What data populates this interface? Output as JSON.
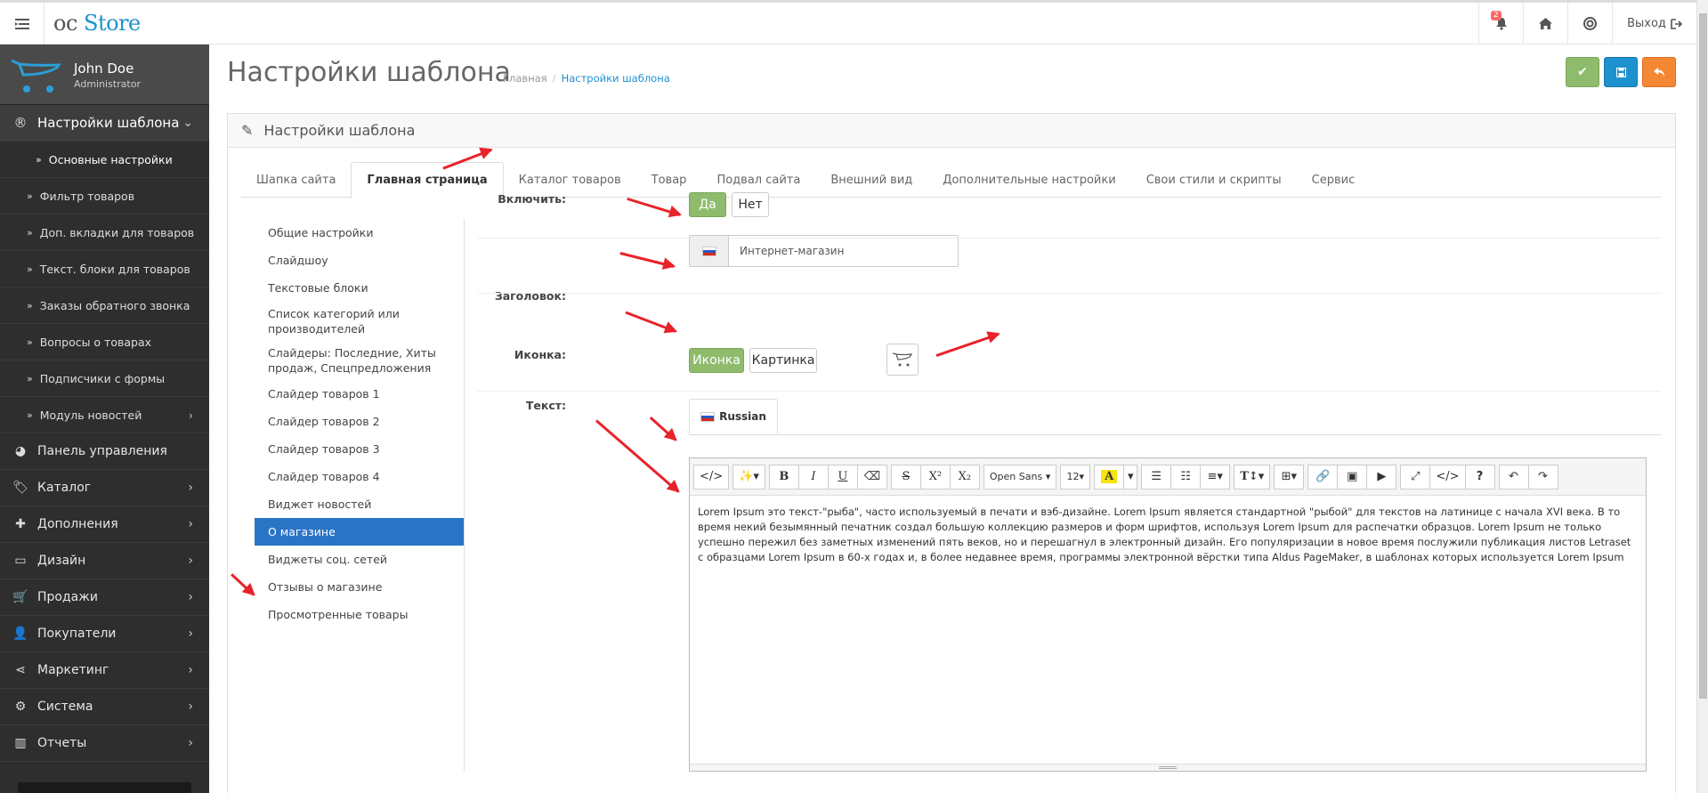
{
  "header": {
    "logo_oc": "oc",
    "logo_store": "Store",
    "notification_count": "2",
    "exit_label": "Выход"
  },
  "user": {
    "name": "John Doe",
    "role": "Administrator"
  },
  "sidebar": {
    "section": "Настройки шаблона",
    "sub_items": [
      {
        "label": "Основные настройки",
        "active": true
      },
      {
        "label": "Фильтр товаров"
      },
      {
        "label": "Доп. вкладки для товаров"
      },
      {
        "label": "Текст. блоки для товаров"
      },
      {
        "label": "Заказы обратного звонка"
      },
      {
        "label": "Вопросы о товарах"
      },
      {
        "label": "Подписчики с формы"
      },
      {
        "label": "Модуль новостей"
      }
    ],
    "items": [
      {
        "label": "Панель управления",
        "icon": "dashboard-icon"
      },
      {
        "label": "Каталог",
        "icon": "tag-icon"
      },
      {
        "label": "Дополнения",
        "icon": "puzzle-icon"
      },
      {
        "label": "Дизайн",
        "icon": "monitor-icon"
      },
      {
        "label": "Продажи",
        "icon": "cart-icon"
      },
      {
        "label": "Покупатели",
        "icon": "user-icon"
      },
      {
        "label": "Маркетинг",
        "icon": "share-icon"
      },
      {
        "label": "Система",
        "icon": "cog-icon"
      },
      {
        "label": "Отчеты",
        "icon": "bar-chart-icon"
      }
    ]
  },
  "page": {
    "title": "Настройки шаблона",
    "breadcrumb_home": "Главная",
    "breadcrumb_current": "Настройки шаблона",
    "panel_title": "Настройки шаблона"
  },
  "tabs": [
    {
      "label": "Шапка сайта"
    },
    {
      "label": "Главная страница",
      "active": true
    },
    {
      "label": "Каталог товаров"
    },
    {
      "label": "Товар"
    },
    {
      "label": "Подвал сайта"
    },
    {
      "label": "Внешний вид"
    },
    {
      "label": "Дополнительные настройки"
    },
    {
      "label": "Свои стили и скрипты"
    },
    {
      "label": "Сервис"
    }
  ],
  "leftnav": [
    "Общие настройки",
    "Слайдшоу",
    "Текстовые блоки",
    "Список категорий или производителей",
    "Слайдеры: Последние, Хиты продаж, Спецпредложения",
    "Слайдер товаров 1",
    "Слайдер товаров 2",
    "Слайдер товаров 3",
    "Слайдер товаров 4",
    "Виджет новостей",
    "О магазине",
    "Виджеты соц. сетей",
    "Отзывы о магазине",
    "Просмотренные товары"
  ],
  "leftnav_active": "О магазине",
  "form": {
    "enable_label": "Включить:",
    "enable_yes": "Да",
    "enable_no": "Нет",
    "heading_label": "Заголовок:",
    "heading_value": "Интернет-магазин",
    "icon_label": "Иконка:",
    "icon_opt1": "Иконка",
    "icon_opt2": "Картинка",
    "text_label": "Текст:",
    "lang_tab": "Russian"
  },
  "editor": {
    "font_family": "Open Sans",
    "font_size": "12",
    "content": "Lorem Ipsum это текст-\"рыба\", часто используемый в печати и вэб-дизайне. Lorem Ipsum является стандартной \"рыбой\" для текстов на латинице с начала XVI века. В то время некий безымянный печатник создал большую коллекцию размеров и форм шрифтов, используя Lorem Ipsum для распечатки образцов. Lorem Ipsum не только успешно пережил без заметных изменений пять веков, но и перешагнул в электронный дизайн. Его популяризации в новое время послужили публикация листов Letraset с образцами Lorem Ipsum в 60-х годах и, в более недавнее время, программы электронной вёрстки типа Aldus PageMaker, в шаблонах которых используется Lorem Ipsum"
  },
  "colors": {
    "accent_blue": "#1e91cf",
    "green": "#8fbb6c",
    "orange": "#f38733",
    "sidebar": "#2e2e2e",
    "active_nav": "#2a74c5",
    "annotation_arrow": "#e8232a"
  }
}
